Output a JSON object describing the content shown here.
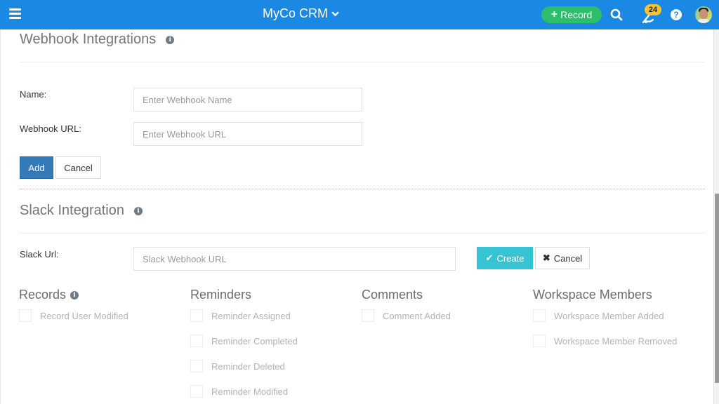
{
  "topbar": {
    "app_title": "MyCo CRM",
    "menu_icon": "hamburger-icon",
    "record_button": "Record",
    "notification_count": "24",
    "help_label": "?",
    "colors": {
      "bar": "#1b88e3",
      "record": "#2ebd6b",
      "badge": "#f7c42c"
    }
  },
  "webhook": {
    "title": "Webhook Integrations",
    "name_label": "Name:",
    "name_placeholder": "Enter Webhook Name",
    "name_value": "",
    "url_label": "Webhook URL:",
    "url_placeholder": "Enter Webhook URL",
    "url_value": "",
    "add_button": "Add",
    "cancel_button": "Cancel"
  },
  "slack": {
    "title": "Slack Integration",
    "url_label": "Slack Url:",
    "url_placeholder": "Slack Webhook URL",
    "url_value": "",
    "create_button": "Create",
    "cancel_button": "Cancel"
  },
  "event_groups": [
    {
      "title": "Records",
      "has_info": true,
      "items": [
        {
          "label": "Record User Modified",
          "checked": false
        }
      ]
    },
    {
      "title": "Reminders",
      "has_info": false,
      "items": [
        {
          "label": "Reminder Assigned",
          "checked": false
        },
        {
          "label": "Reminder Completed",
          "checked": false
        },
        {
          "label": "Reminder Deleted",
          "checked": false
        },
        {
          "label": "Reminder Modified",
          "checked": false
        }
      ]
    },
    {
      "title": "Comments",
      "has_info": false,
      "items": [
        {
          "label": "Comment Added",
          "checked": false
        }
      ]
    },
    {
      "title": "Workspace Members",
      "has_info": false,
      "items": [
        {
          "label": "Workspace Member Added",
          "checked": false
        },
        {
          "label": "Workspace Member Removed",
          "checked": false
        }
      ]
    }
  ]
}
